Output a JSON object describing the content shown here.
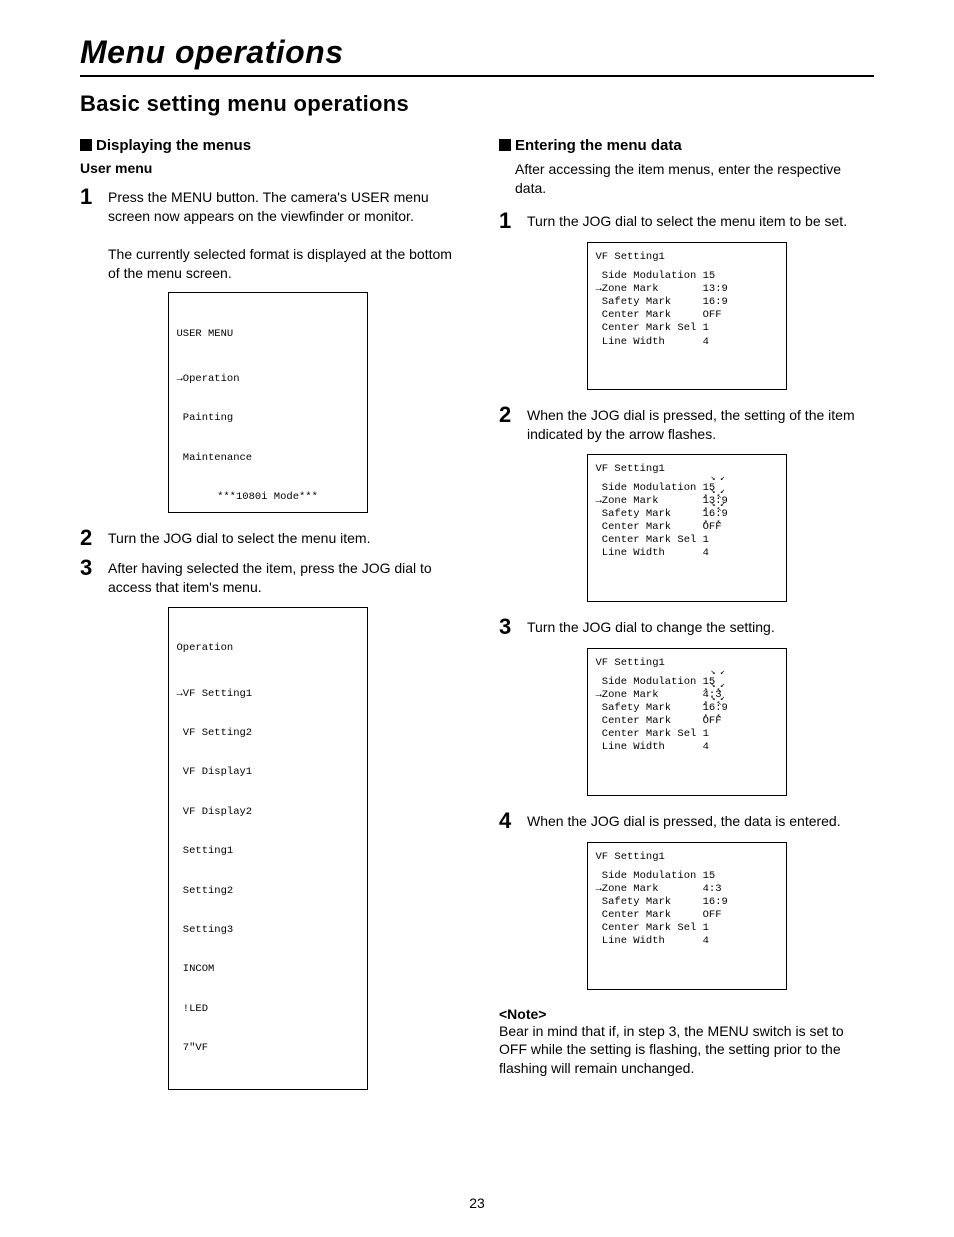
{
  "title": "Menu operations",
  "section": "Basic setting menu operations",
  "page_number": "23",
  "left": {
    "head1": "Displaying the menus",
    "subhead": "User menu",
    "step1": "Press the MENU button.\nThe camera's USER menu screen now appears on the viewfinder or monitor.",
    "step1b": "The currently selected format is displayed at the bottom of the menu screen.",
    "screen1": {
      "title": "USER MENU",
      "lines": [
        "→Operation",
        " Painting",
        " Maintenance"
      ],
      "bottom": "***1080i Mode***"
    },
    "step2": "Turn the JOG dial to select the menu item.",
    "step3": "After having selected the item, press the JOG dial to access that item's menu.",
    "screen2": {
      "title": "Operation",
      "lines": [
        "→VF Setting1",
        " VF Setting2",
        " VF Display1",
        " VF Display2",
        " Setting1",
        " Setting2",
        " Setting3",
        " INCOM",
        " !LED",
        " 7\"VF"
      ]
    }
  },
  "right": {
    "head1": "Entering the menu data",
    "intro": "After accessing the item menus, enter the respective data.",
    "step1": "Turn the JOG dial to select the menu item to be set.",
    "vf_title": "VF Setting1",
    "vf_items": [
      {
        "label": " Side Modulation",
        "v1": "15",
        "v2": "15",
        "v3": "15",
        "v4": "15"
      },
      {
        "label": "→Zone Mark",
        "v1": "13:9",
        "v2": "13:9",
        "v3": "4:3",
        "v4": "4:3"
      },
      {
        "label": " Safety Mark",
        "v1": "16:9",
        "v2": "16:9",
        "v3": "16:9",
        "v4": "16:9"
      },
      {
        "label": " Center Mark",
        "v1": "OFF",
        "v2": "OFF",
        "v3": "OFF",
        "v4": "OFF"
      },
      {
        "label": " Center Mark Sel",
        "v1": "1",
        "v2": "1",
        "v3": "1",
        "v4": "1"
      },
      {
        "label": " Line Width",
        "v1": "4",
        "v2": "4",
        "v3": "4",
        "v4": "4"
      }
    ],
    "step2": "When the JOG dial is pressed, the setting of the item indicated by the arrow flashes.",
    "step3": "Turn the JOG dial to change the setting.",
    "step4": "When the JOG dial is pressed, the data is entered.",
    "note_head": "<Note>",
    "note": "Bear in mind that if, in step 3, the MENU switch is set to OFF while the setting is flashing, the setting prior to the flashing will remain unchanged."
  }
}
